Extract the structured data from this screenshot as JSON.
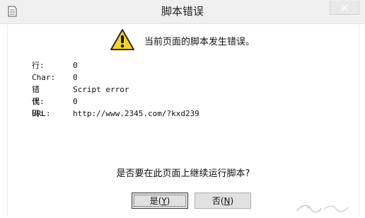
{
  "window": {
    "title": "脚本错误"
  },
  "message": {
    "headline": "当前页面的脚本发生错误。"
  },
  "details": [
    {
      "label": "行:",
      "value": "0"
    },
    {
      "label": "Char:",
      "value": "0"
    },
    {
      "label": "错误:",
      "value": "Script error"
    },
    {
      "label": "代码:",
      "value": "0"
    },
    {
      "label": "URL:",
      "value": "http://www.2345.com/?kxd239"
    }
  ],
  "prompt": {
    "question": "是否要在此页面上继续运行脚本?"
  },
  "buttons": {
    "yes_label": "是(",
    "yes_key": "Y",
    "yes_end": ")",
    "no_label": "否(",
    "no_key": "N",
    "no_end": ")"
  },
  "icons": {
    "app": "document-icon",
    "warning": "warning-icon",
    "close": "close-icon"
  },
  "colors": {
    "warning_fill": "#f7d417",
    "warning_border": "#2b2b2b",
    "titlebar_bg": "#f0f0f0"
  }
}
